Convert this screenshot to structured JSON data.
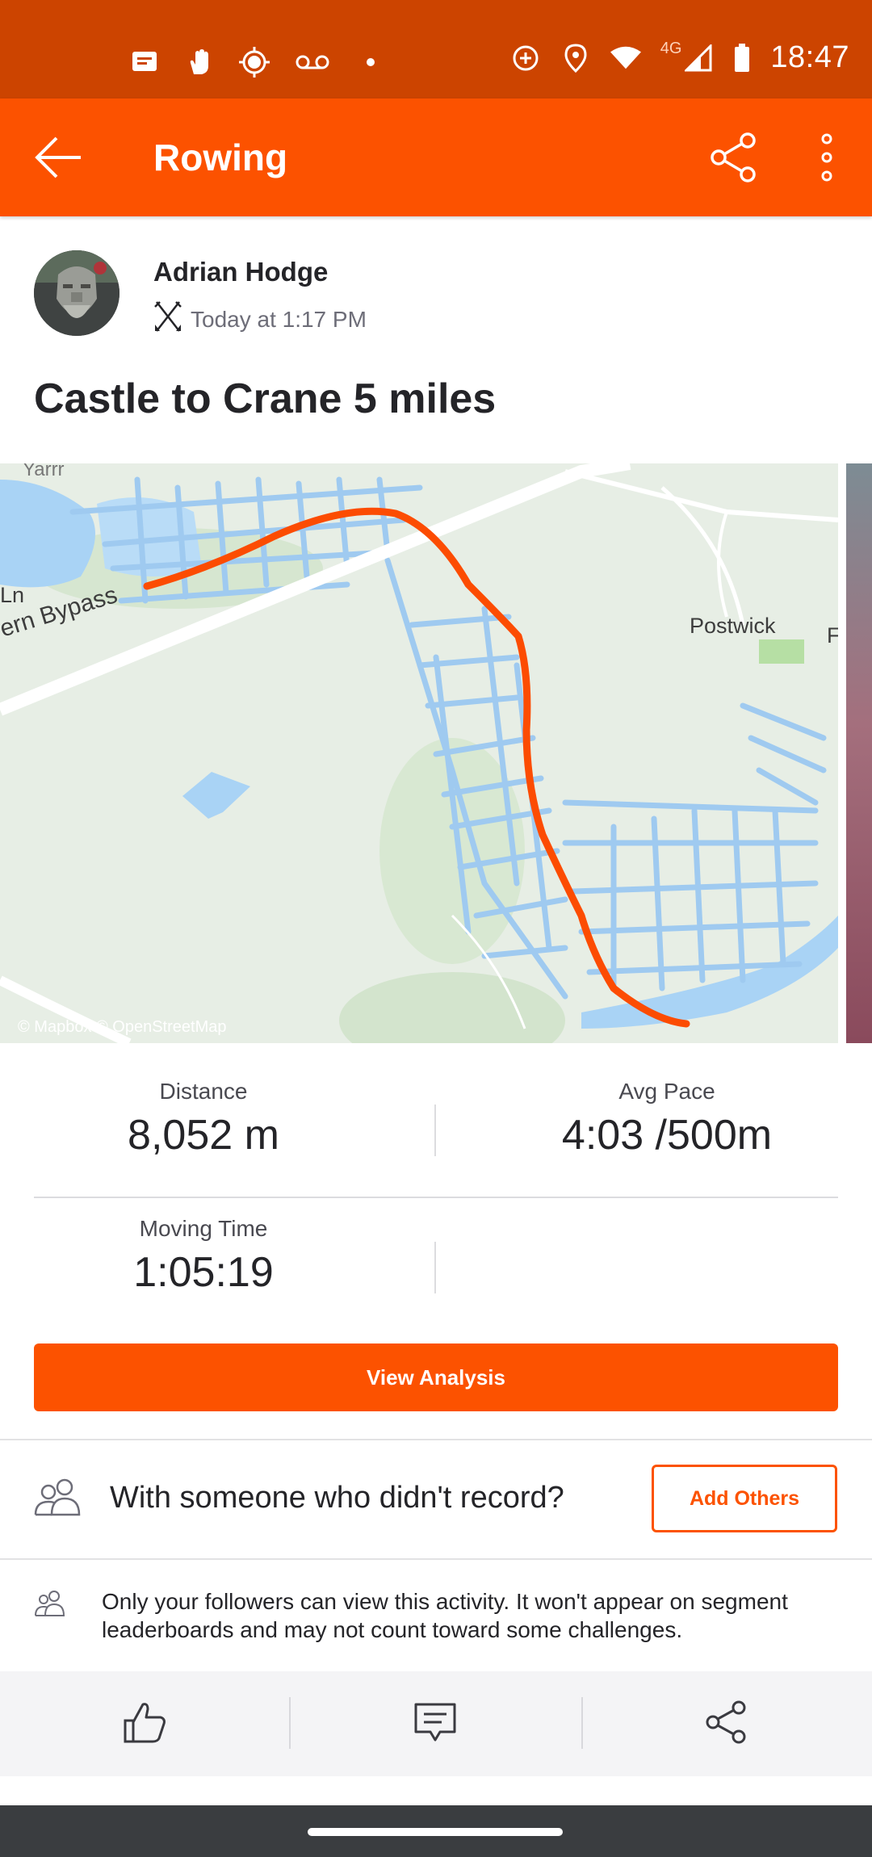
{
  "status_bar": {
    "time": "18:47",
    "network": "4G",
    "left_icons": [
      "message-icon",
      "hand-icon",
      "brightness-icon",
      "voicemail-icon",
      "dot-icon"
    ],
    "right_icons": [
      "data-saver-icon",
      "location-icon",
      "wifi-icon",
      "signal-icon",
      "battery-icon"
    ]
  },
  "app_bar": {
    "title": "Rowing"
  },
  "athlete": {
    "name": "Adrian Hodge",
    "timestamp": "Today at 1:17 PM",
    "sport_icon": "oars-icon"
  },
  "activity": {
    "title": "Castle to Crane 5 miles"
  },
  "map": {
    "labels": {
      "town": "Postwick",
      "road": "ern Bypass",
      "lane": "Ln",
      "top_left": "Yarrr",
      "edge": "F"
    },
    "credit": "© Mapbox © OpenStreetMap",
    "route_color": "#fc4c02",
    "water_color": "#a9d3f5"
  },
  "stats": {
    "distance_label": "Distance",
    "distance_value": "8,052 m",
    "pace_label": "Avg Pace",
    "pace_value": "4:03 /500m",
    "moving_time_label": "Moving Time",
    "moving_time_value": "1:05:19"
  },
  "buttons": {
    "view_analysis": "View Analysis",
    "add_others": "Add Others"
  },
  "with_others": {
    "text": "With someone who didn't record?"
  },
  "privacy": {
    "text": "Only your followers can view this activity. It won't appear on segment leaderboards and may not count toward some challenges."
  },
  "actions": [
    "like-icon",
    "comment-icon",
    "share-icon"
  ],
  "colors": {
    "brand": "#fc5200",
    "status_bar": "#cc4400"
  }
}
